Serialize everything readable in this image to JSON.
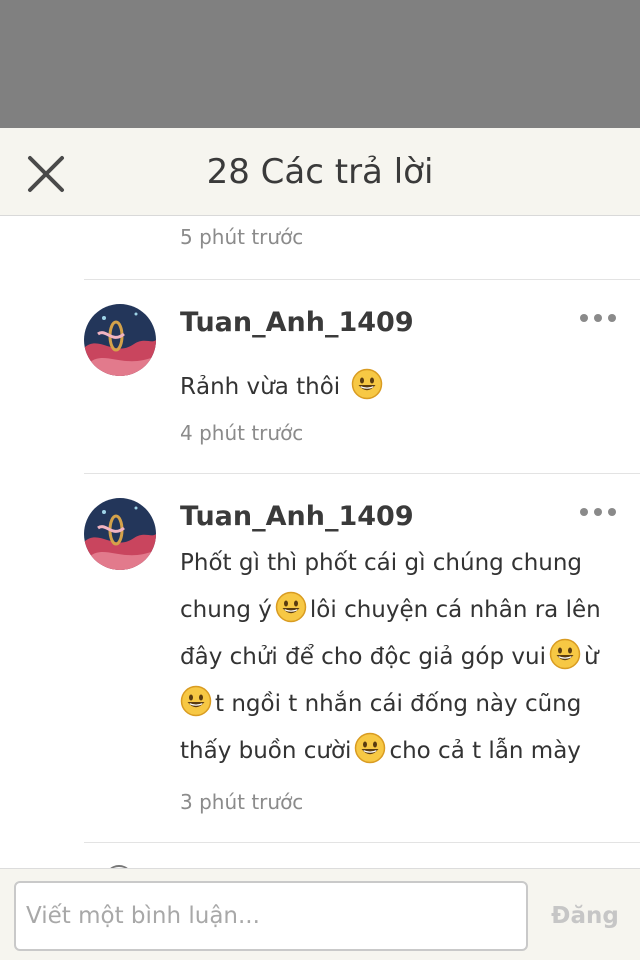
{
  "header": {
    "title": "28 Các trả lời"
  },
  "first_comment": {
    "time": "5 phút trước"
  },
  "comments": [
    {
      "username": "Tuan_Anh_1409",
      "text": "Rảnh vừa thôi",
      "time": "4 phút trước"
    },
    {
      "username": "Tuan_Anh_1409",
      "lines": [
        [
          "Phốt gì thì phốt cái gì chúng chung"
        ],
        [
          "chung ý",
          "lôi chuyện cá nhân ra lên"
        ],
        [
          "đây chửi để cho độc giả góp vui",
          "ừ"
        ],
        [
          "",
          "t ngồi t nhắn cái đống này cũng"
        ],
        [
          "thấy buồn cười",
          "cho cả t lẫn mày"
        ]
      ],
      "time": "3 phút trước"
    }
  ],
  "footer": {
    "placeholder": "Viết một bình luận...",
    "post_label": "Đăng"
  },
  "icons": {
    "close": "close-icon",
    "more": "more-dots-icon",
    "emoji": "grinning-emoji-icon"
  },
  "colors": {
    "header_bg": "#f6f5ef",
    "overlay": "#808080",
    "muted_text": "#8b8b8b",
    "post_disabled": "#c6c6c6"
  }
}
